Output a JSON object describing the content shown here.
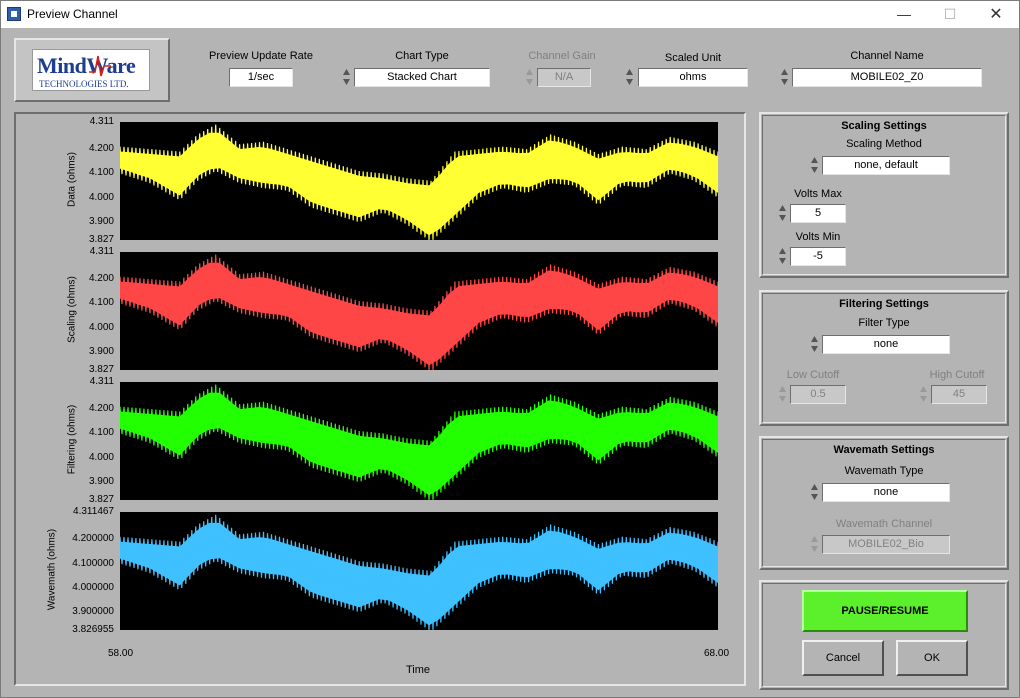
{
  "window": {
    "title": "Preview Channel",
    "minimize": "—",
    "maximize": "☐",
    "close": "✕"
  },
  "logo": {
    "brand": "MindWare",
    "subtitle": "TECHNOLOGIES LTD."
  },
  "toolbar": {
    "update_rate": {
      "label": "Preview Update Rate",
      "value": "1/sec"
    },
    "chart_type": {
      "label": "Chart Type",
      "value": "Stacked Chart"
    },
    "channel_gain": {
      "label": "Channel Gain",
      "value": "N/A",
      "disabled": true
    },
    "scaled_unit": {
      "label": "Scaled Unit",
      "value": "ohms"
    },
    "channel_name": {
      "label": "Channel Name",
      "value": "MOBILE02_Z0"
    }
  },
  "scaling": {
    "title": "Scaling Settings",
    "method_label": "Scaling Method",
    "method_value": "none, default",
    "vmax_label": "Volts Max",
    "vmax_value": "5",
    "vmin_label": "Volts Min",
    "vmin_value": "-5"
  },
  "filtering": {
    "title": "Filtering Settings",
    "type_label": "Filter Type",
    "type_value": "none",
    "low_label": "Low Cutoff",
    "low_value": "0.5",
    "high_label": "High Cutoff",
    "high_value": "45"
  },
  "wavemath": {
    "title": "Wavemath Settings",
    "type_label": "Wavemath Type",
    "type_value": "none",
    "channel_label": "Wavemath Channel",
    "channel_value": "MOBILE02_Bio"
  },
  "buttons": {
    "pause": "PAUSE/RESUME",
    "cancel": "Cancel",
    "ok": "OK"
  },
  "colors": {
    "data": "#ffff33",
    "scaling": "#ff4646",
    "filtering": "#22ff00",
    "wavemath": "#3fc0ff"
  },
  "chart_data": [
    {
      "type": "area",
      "ylabel": "Data (ohms)",
      "ylim": [
        3.827,
        4.311
      ],
      "yticks": [
        "4.311",
        "4.200",
        "4.100",
        "4.000",
        "3.900",
        "3.827"
      ],
      "color": "#ffff33",
      "xlabel": "Time",
      "xlim": [
        58.0,
        68.0
      ]
    },
    {
      "type": "area",
      "ylabel": "Scaling (ohms)",
      "ylim": [
        3.827,
        4.311
      ],
      "yticks": [
        "4.311",
        "4.200",
        "4.100",
        "4.000",
        "3.900",
        "3.827"
      ],
      "color": "#ff4646",
      "xlabel": "Time",
      "xlim": [
        58.0,
        68.0
      ]
    },
    {
      "type": "area",
      "ylabel": "Filtering (ohms)",
      "ylim": [
        3.827,
        4.311
      ],
      "yticks": [
        "4.311",
        "4.200",
        "4.100",
        "4.000",
        "3.900",
        "3.827"
      ],
      "color": "#22ff00",
      "xlabel": "Time",
      "xlim": [
        58.0,
        68.0
      ]
    },
    {
      "type": "area",
      "ylabel": "Wavemath (ohms)",
      "ylim": [
        3.826955,
        4.311467
      ],
      "yticks": [
        "4.311467",
        "4.200000",
        "4.100000",
        "4.000000",
        "3.900000",
        "3.826955"
      ],
      "color": "#3fc0ff",
      "xlabel": "Time",
      "xlim": [
        58.0,
        68.0
      ]
    }
  ],
  "signal_envelope": {
    "x": [
      58.0,
      58.5,
      59.0,
      59.3,
      59.6,
      60.0,
      60.4,
      60.8,
      61.2,
      61.6,
      62.0,
      62.4,
      62.8,
      63.2,
      63.6,
      64.0,
      64.4,
      64.8,
      65.2,
      65.6,
      66.0,
      66.4,
      66.8,
      67.2,
      67.6,
      68.0
    ],
    "upper": [
      4.21,
      4.2,
      4.19,
      4.26,
      4.3,
      4.22,
      4.23,
      4.2,
      4.17,
      4.14,
      4.11,
      4.1,
      4.08,
      4.07,
      4.19,
      4.2,
      4.21,
      4.2,
      4.26,
      4.23,
      4.18,
      4.21,
      4.2,
      4.25,
      4.23,
      4.19
    ],
    "lower": [
      4.1,
      4.06,
      3.99,
      4.07,
      4.11,
      4.06,
      4.04,
      4.03,
      3.96,
      3.93,
      3.9,
      3.94,
      3.89,
      3.82,
      3.91,
      4.0,
      4.04,
      4.02,
      4.06,
      4.05,
      3.97,
      4.05,
      4.04,
      4.1,
      4.07,
      4.0
    ]
  },
  "xaxis": {
    "start": "58.00",
    "end": "68.00",
    "title": "Time"
  }
}
